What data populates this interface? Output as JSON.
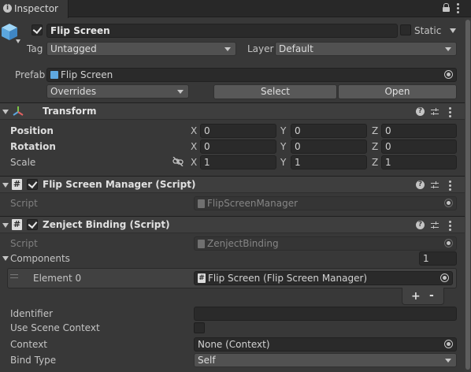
{
  "tab": {
    "title": "Inspector"
  },
  "gameobject": {
    "name": "Flip Screen",
    "static_label": "Static",
    "tag_label": "Tag",
    "tag_value": "Untagged",
    "layer_label": "Layer",
    "layer_value": "Default",
    "prefab_label": "Prefab",
    "prefab_value": "Flip Screen",
    "overrides_value": "Overrides",
    "select_label": "Select",
    "open_label": "Open"
  },
  "transform": {
    "title": "Transform",
    "position_label": "Position",
    "rotation_label": "Rotation",
    "scale_label": "Scale",
    "axis_x": "X",
    "axis_y": "Y",
    "axis_z": "Z",
    "position": {
      "x": "0",
      "y": "0",
      "z": "0"
    },
    "rotation": {
      "x": "0",
      "y": "0",
      "z": "0"
    },
    "scale": {
      "x": "1",
      "y": "1",
      "z": "1"
    }
  },
  "flip_manager": {
    "title": "Flip Screen Manager (Script)",
    "script_label": "Script",
    "script_value": "FlipScreenManager"
  },
  "zenject": {
    "title": "Zenject Binding (Script)",
    "script_label": "Script",
    "script_value": "ZenjectBinding",
    "components_label": "Components",
    "components_count": "1",
    "element0_label": "Element 0",
    "element0_value": "Flip Screen (Flip Screen Manager)",
    "add_label": "+",
    "remove_label": "-",
    "identifier_label": "Identifier",
    "identifier_value": "",
    "use_scene_context_label": "Use Scene Context",
    "context_label": "Context",
    "context_value": "None (Context)",
    "bind_type_label": "Bind Type",
    "bind_type_value": "Self"
  },
  "colors": {
    "background": "#383838",
    "field": "#2a2a2a",
    "header": "#3e3e3e",
    "prefab_blue": "#5fa8e0"
  },
  "icons": [
    "info-icon",
    "lock-icon",
    "kebab-icon",
    "cube-icon",
    "transform-icon",
    "script-icon",
    "help-icon",
    "preset-icon",
    "target-icon",
    "link-icon"
  ]
}
